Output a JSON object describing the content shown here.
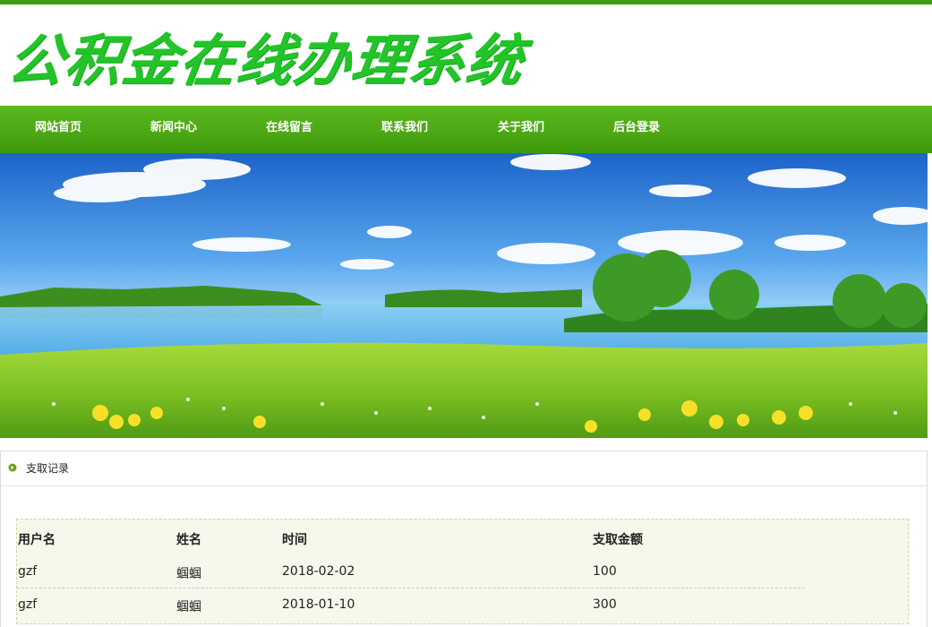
{
  "header": {
    "logo_text": "公积金在线办理系统"
  },
  "nav": {
    "items": [
      {
        "label": "网站首页"
      },
      {
        "label": "新闻中心"
      },
      {
        "label": "在线留言"
      },
      {
        "label": "联系我们"
      },
      {
        "label": "关于我们"
      },
      {
        "label": "后台登录"
      }
    ]
  },
  "panel": {
    "title": "支取记录"
  },
  "table": {
    "headers": [
      "用户名",
      "姓名",
      "时间",
      "支取金额"
    ],
    "rows": [
      [
        "gzf",
        "蝈蝈",
        "2018-02-02",
        "100"
      ],
      [
        "gzf",
        "蝈蝈",
        "2018-01-10",
        "300"
      ]
    ]
  },
  "colors": {
    "accent_green": "#3f9e12",
    "logo_green": "#22c428"
  },
  "icons": {
    "panel_icon": "circle-bullet-icon"
  }
}
